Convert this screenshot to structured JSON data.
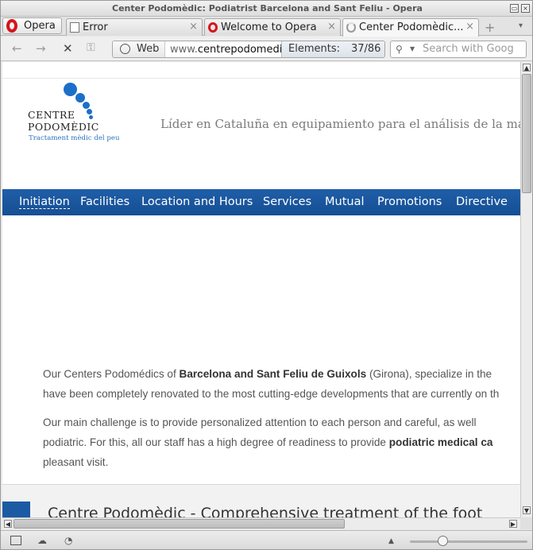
{
  "window": {
    "title": "Center Podomèdic: Podiatrist Barcelona and Sant Feliu - Opera",
    "minimize_glyph": "▭",
    "close_glyph": "×"
  },
  "opera_menu": {
    "label": "Opera",
    "icon": "opera-logo-icon"
  },
  "tabs": [
    {
      "label": "Error",
      "close": "×",
      "icon": "page-icon"
    },
    {
      "label": "Welcome to Opera",
      "close": "×",
      "icon": "opera-icon"
    },
    {
      "label": "Center Podomèdic...",
      "close": "×",
      "icon": "loading-icon"
    }
  ],
  "newtab_glyph": "+",
  "tab_menu_glyph": "▾",
  "nav": {
    "back": "←",
    "forward": "→",
    "stop": "✕",
    "key": "⚿",
    "web_label": "Web",
    "url_prefix": "www.",
    "url_host": "centrepodomedic",
    "elements_label": "Elements:",
    "elements_count": "37/86",
    "search_placeholder": "Search with Goog"
  },
  "page": {
    "logo": {
      "line1": "CENTRE",
      "line2": "PODOMÈDIC",
      "tagline": "Tractament mèdic del peu",
      "accent_color": "#1c6fc8"
    },
    "slogan": "Líder en Cataluña en equipamiento para el análisis de la marcha, bio",
    "menu": [
      "Initiation",
      "Facilities",
      "Location and Hours",
      "Services",
      "Mutual",
      "Promotions",
      "Directive"
    ],
    "menu_color": "#1f5ea8",
    "p1": {
      "a": "Our Centers Podomédics of ",
      "b": "Barcelona and Sant Feliu de Guixols",
      "c": " (Girona), specialize in the",
      "line2": "have been completely renovated to the most cutting-edge developments that are currently on th"
    },
    "p2": {
      "line1": "Our main challenge is to provide personalized attention to each person and careful, as well",
      "line2a": "podiatric. For this, all our staff has a high degree of readiness to provide ",
      "line2b": "podiatric medical ca",
      "line3": "pleasant visit."
    },
    "heading2": "Centre Podomèdic - Comprehensive treatment of the foot"
  },
  "scroll": {
    "up": "▲",
    "down": "▼",
    "left": "◀",
    "right": "▶"
  },
  "status": {
    "cloud": "☁",
    "speed": "◔",
    "up": "▲"
  }
}
